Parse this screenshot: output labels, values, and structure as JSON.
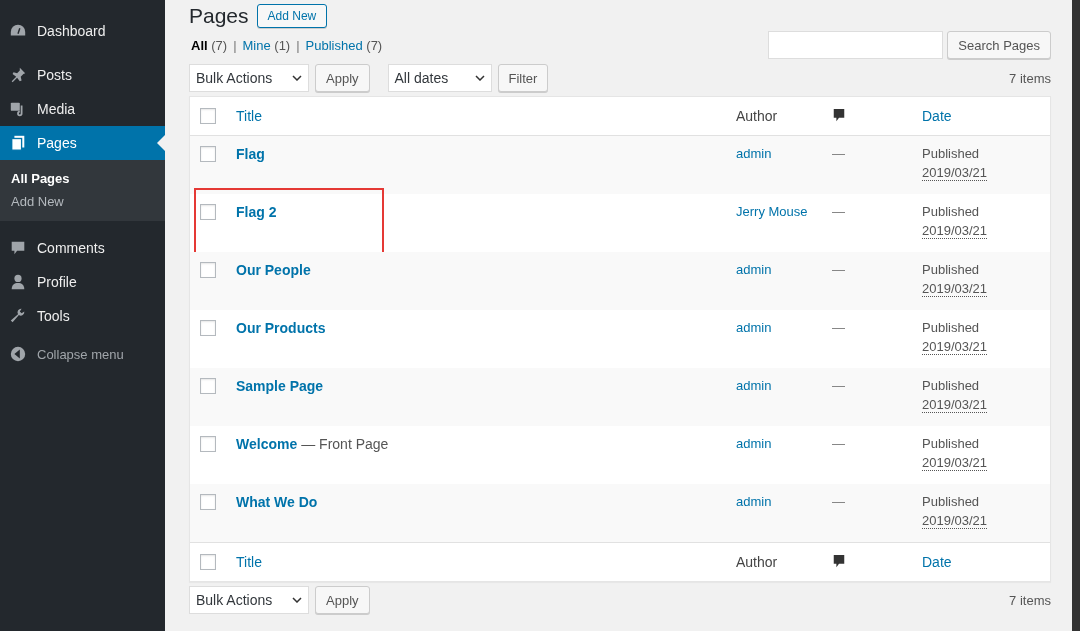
{
  "sidebar": {
    "items": [
      {
        "label": "Dashboard",
        "selected": false
      },
      {
        "label": "Posts",
        "selected": false
      },
      {
        "label": "Media",
        "selected": false
      },
      {
        "label": "Pages",
        "selected": true,
        "children": [
          {
            "label": "All Pages",
            "selected": true
          },
          {
            "label": "Add New",
            "selected": false
          }
        ]
      },
      {
        "label": "Comments",
        "selected": false
      },
      {
        "label": "Profile",
        "selected": false
      },
      {
        "label": "Tools",
        "selected": false
      },
      {
        "label": "Collapse menu",
        "selected": false
      }
    ]
  },
  "heading": {
    "title": "Pages",
    "button": "Add New"
  },
  "filters": [
    {
      "label": "All",
      "count": "(7)",
      "selected": true
    },
    {
      "label": "Mine",
      "count": "(1)",
      "selected": false,
      "separator": "|"
    },
    {
      "label": "Published",
      "count": "(7)",
      "selected": false,
      "separator": "|"
    }
  ],
  "search": {
    "button": "Search Pages"
  },
  "top_nav": {
    "bulk": "Bulk Actions",
    "apply": "Apply",
    "dates": "All dates",
    "filter": "Filter",
    "count": "7 items"
  },
  "table": {
    "columns": [
      "Title",
      "Author",
      "Date"
    ],
    "select_all_checked": false,
    "footer_select_all_checked": false,
    "rows": [
      {
        "title": "Flag",
        "suffix": "",
        "author": "admin",
        "comments": "—",
        "status": "Published",
        "date": "2019/03/21",
        "checked": false,
        "highlighted": false
      },
      {
        "title": "Flag 2",
        "suffix": "",
        "author": "Jerry Mouse",
        "comments": "—",
        "status": "Published",
        "date": "2019/03/21",
        "checked": false,
        "highlighted": true
      },
      {
        "title": "Our People",
        "suffix": "",
        "author": "admin",
        "comments": "—",
        "status": "Published",
        "date": "2019/03/21",
        "checked": false,
        "highlighted": false
      },
      {
        "title": "Our Products",
        "suffix": "",
        "author": "admin",
        "comments": "—",
        "status": "Published",
        "date": "2019/03/21",
        "checked": false,
        "highlighted": false
      },
      {
        "title": "Sample Page",
        "suffix": "",
        "author": "admin",
        "comments": "—",
        "status": "Published",
        "date": "2019/03/21",
        "checked": false,
        "highlighted": false
      },
      {
        "title": "Welcome",
        "suffix": "— Front Page",
        "author": "admin",
        "comments": "—",
        "status": "Published",
        "date": "2019/03/21",
        "checked": false,
        "highlighted": false
      },
      {
        "title": "What We Do",
        "suffix": "",
        "author": "admin",
        "comments": "—",
        "status": "Published",
        "date": "2019/03/21",
        "checked": false,
        "highlighted": false
      }
    ],
    "footer_columns": [
      "Title",
      "Author",
      "Date"
    ]
  },
  "bottom_nav": {
    "bulk": "Bulk Actions",
    "apply": "Apply",
    "count": "7 items"
  }
}
